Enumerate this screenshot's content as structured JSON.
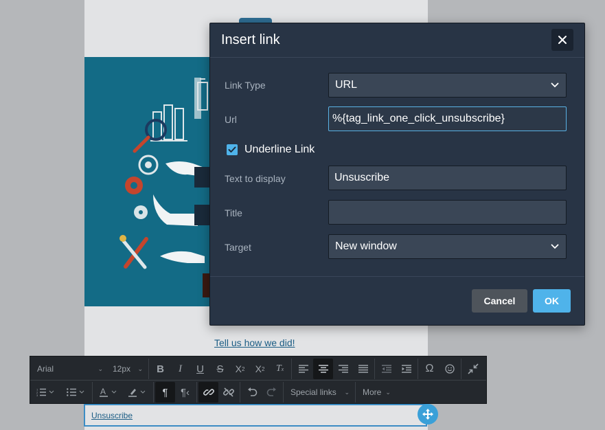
{
  "background": {
    "feedback_link": "Tell us how we did!",
    "unsubscribe_text": "Unsuscribe"
  },
  "toolbar": {
    "font_family": "Arial",
    "font_size": "12px",
    "special_links_label": "Special links",
    "more_label": "More",
    "row1_icons": [
      "bold-icon",
      "italic-icon",
      "underline-icon",
      "strikethrough-icon",
      "superscript-icon",
      "subscript-icon",
      "clear-format-icon",
      "align-left-icon",
      "align-center-icon",
      "align-right-icon",
      "align-justify-icon",
      "outdent-icon",
      "indent-icon",
      "omega-icon",
      "emoji-icon",
      "collapse-icon"
    ],
    "row2_icons": [
      "numbered-list-icon",
      "bullet-list-icon",
      "text-color-icon",
      "highlight-icon",
      "ltr-icon",
      "rtl-icon",
      "link-icon",
      "unlink-icon",
      "undo-icon",
      "redo-icon"
    ]
  },
  "dialog": {
    "title": "Insert link",
    "close_symbol": "✕",
    "fields": {
      "link_type": {
        "label": "Link Type",
        "value": "URL"
      },
      "url": {
        "label": "Url",
        "value": "%{tag_link_one_click_unsubscribe}"
      },
      "underline": {
        "label": "Underline Link",
        "checked": true
      },
      "text_to_display": {
        "label": "Text to display",
        "value": "Unsuscribe"
      },
      "title": {
        "label": "Title",
        "value": ""
      },
      "target": {
        "label": "Target",
        "value": "New window"
      }
    },
    "buttons": {
      "cancel": "Cancel",
      "ok": "OK"
    }
  },
  "colors": {
    "accent": "#4fb3ea",
    "dialog_bg": "#283445",
    "toolbar_bg": "#24282d",
    "hero_bg": "#136b86"
  }
}
